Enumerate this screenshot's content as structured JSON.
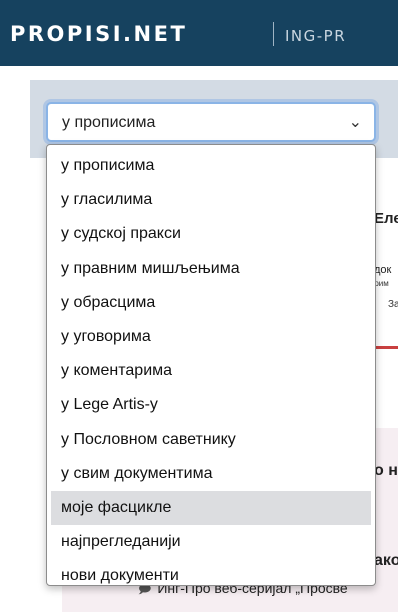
{
  "header": {
    "logo_text": "PROPISI.NET",
    "logo_subtext": "ING-PR"
  },
  "search": {
    "selected": "у прописима",
    "options": [
      "у прописима",
      "у гласилима",
      "у судској пракси",
      "у правним мишљењима",
      "у обрасцима",
      "у уговорима",
      "у коментарима",
      "у Lege Artis-у",
      "у Пословном саветнику",
      "у свим документима",
      "моје фасцикле",
      "најпрегледанији",
      "нови документи"
    ],
    "highlighted_index": 10
  },
  "background": {
    "card_title": "Еле",
    "card_line1": "док",
    "card_line2": "прим",
    "card_line3": "За",
    "heading1": "о н",
    "heading2": "ако",
    "link_text": "Инг-Про веб-серијал „Просве"
  },
  "colors": {
    "header_bg": "#16425f",
    "panel_bg": "#d3dbe4",
    "focus_border": "#8ab4e6",
    "highlight": "#dcdde0",
    "card_accent": "#c94040",
    "section_bg": "#f6eef2"
  }
}
